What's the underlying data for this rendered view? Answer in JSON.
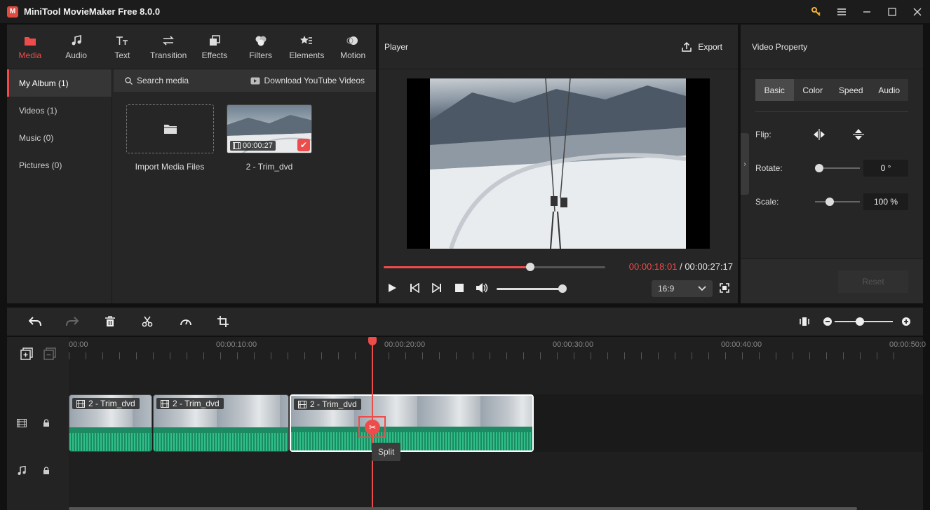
{
  "window": {
    "title": "MiniTool MovieMaker Free 8.0.0",
    "logo_letter": "M"
  },
  "tabs": [
    {
      "label": "Media",
      "icon": "folder-icon",
      "active": true
    },
    {
      "label": "Audio",
      "icon": "music-icon"
    },
    {
      "label": "Text",
      "icon": "text-icon"
    },
    {
      "label": "Transition",
      "icon": "transition-icon"
    },
    {
      "label": "Effects",
      "icon": "effects-icon"
    },
    {
      "label": "Filters",
      "icon": "filters-icon"
    },
    {
      "label": "Elements",
      "icon": "elements-icon"
    },
    {
      "label": "Motion",
      "icon": "motion-icon"
    }
  ],
  "sidebar": {
    "items": [
      {
        "label": "My Album (1)",
        "active": true
      },
      {
        "label": "Videos (1)"
      },
      {
        "label": "Music (0)"
      },
      {
        "label": "Pictures (0)"
      }
    ]
  },
  "media": {
    "search_label": "Search media",
    "download_label": "Download YouTube Videos",
    "import_label": "Import Media Files",
    "clip": {
      "name": "2 - Trim_dvd",
      "duration": "00:00:27"
    }
  },
  "player": {
    "title": "Player",
    "export_label": "Export",
    "current_time": "00:00:18:01",
    "separator": " / ",
    "total_time": "00:00:27:17",
    "progress": 0.66,
    "volume": 1.0,
    "ratio": "16:9"
  },
  "property": {
    "title": "Video Property",
    "tabs": [
      "Basic",
      "Color",
      "Speed",
      "Audio"
    ],
    "active_tab": "Basic",
    "flip_label": "Flip:",
    "rotate_label": "Rotate:",
    "rotate_value": "0 °",
    "scale_label": "Scale:",
    "scale_value": "100 %",
    "reset_label": "Reset"
  },
  "timeline": {
    "ruler_labels": [
      "00:00",
      "00:00:10:00",
      "00:00:20:00",
      "00:00:30:00",
      "00:00:40:00",
      "00:00:50:0"
    ],
    "clips": [
      {
        "name": "2 - Trim_dvd"
      },
      {
        "name": "2 - Trim_dvd"
      },
      {
        "name": "2 - Trim_dvd",
        "selected": true
      }
    ],
    "tooltip": "Split"
  },
  "colors": {
    "accent": "#ee4b4b",
    "panel": "#262626",
    "waveform": "#2fbf88"
  }
}
